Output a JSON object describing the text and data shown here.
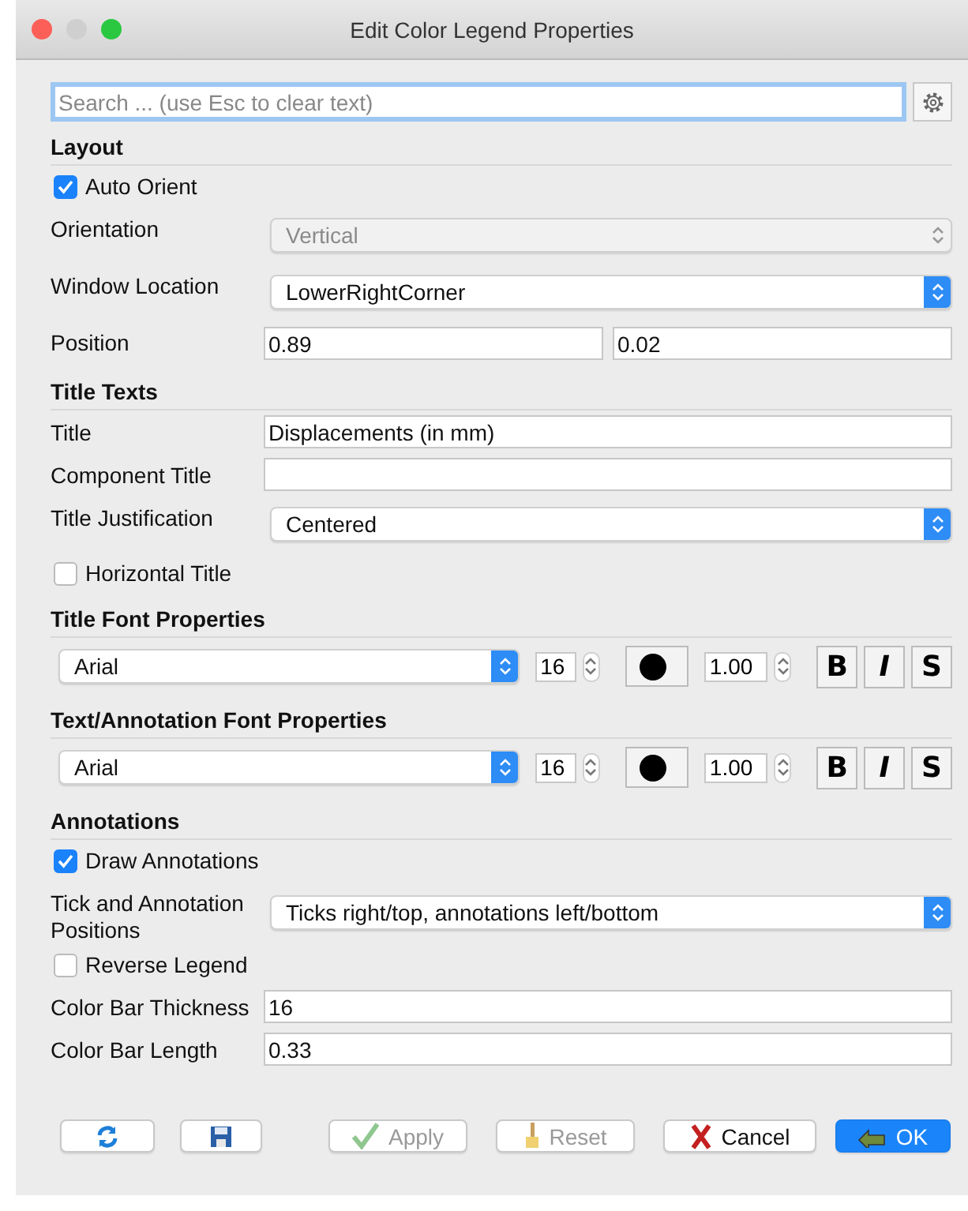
{
  "window": {
    "title": "Edit Color Legend Properties"
  },
  "search": {
    "placeholder": "Search ... (use Esc to clear text)"
  },
  "sections": [
    {
      "title": "Layout",
      "rows": [
        {
          "kind": "checkbox",
          "label": "Auto Orient",
          "checked": true
        },
        {
          "kind": "select",
          "label": "Orientation",
          "value": "Vertical",
          "disabled": true
        },
        {
          "kind": "select",
          "label": "Window Location",
          "value": "LowerRightCorner",
          "disabled": false
        },
        {
          "kind": "pair",
          "label": "Position",
          "values": [
            "0.89",
            "0.02"
          ]
        }
      ]
    },
    {
      "title": "Title Texts",
      "rows": [
        {
          "kind": "text",
          "label": "Title",
          "value": "Displacements (in mm)"
        },
        {
          "kind": "text",
          "label": "Component Title"
        },
        {
          "kind": "select",
          "label": "Title Justification",
          "value": "Centered",
          "disabled": false
        },
        {
          "kind": "checkbox",
          "label": "Horizontal Title",
          "checked": false
        }
      ]
    },
    {
      "title": "Title Font Properties",
      "rows": [
        {
          "kind": "font",
          "family": "Arial",
          "size": "16",
          "opacity": "1.00",
          "styles": [
            "B",
            "I",
            "S"
          ]
        }
      ]
    },
    {
      "title": "Text/Annotation Font Properties",
      "rows": [
        {
          "kind": "font",
          "family": "Arial",
          "size": "16",
          "opacity": "1.00",
          "styles": [
            "B",
            "I",
            "S"
          ]
        }
      ]
    },
    {
      "title": "Annotations",
      "rows": [
        {
          "kind": "checkbox",
          "label": "Draw Annotations",
          "checked": true
        },
        {
          "kind": "select",
          "label": "Tick and Annotation Positions",
          "value": "Ticks right/top, annotations left/bottom",
          "disabled": false
        },
        {
          "kind": "checkbox",
          "label": "Reverse Legend",
          "checked": false
        },
        {
          "kind": "text",
          "label": "Color Bar Thickness",
          "value": "16"
        },
        {
          "kind": "text",
          "label": "Color Bar Length",
          "value": "0.33"
        }
      ]
    }
  ],
  "buttons": [
    {
      "kind": "refresh"
    },
    {
      "kind": "save"
    },
    {
      "kind": "apply",
      "label": "Apply",
      "disabled": true
    },
    {
      "kind": "reset",
      "label": "Reset",
      "disabled": true
    },
    {
      "kind": "cancel",
      "label": "Cancel",
      "disabled": false
    },
    {
      "kind": "ok",
      "label": "OK"
    }
  ]
}
